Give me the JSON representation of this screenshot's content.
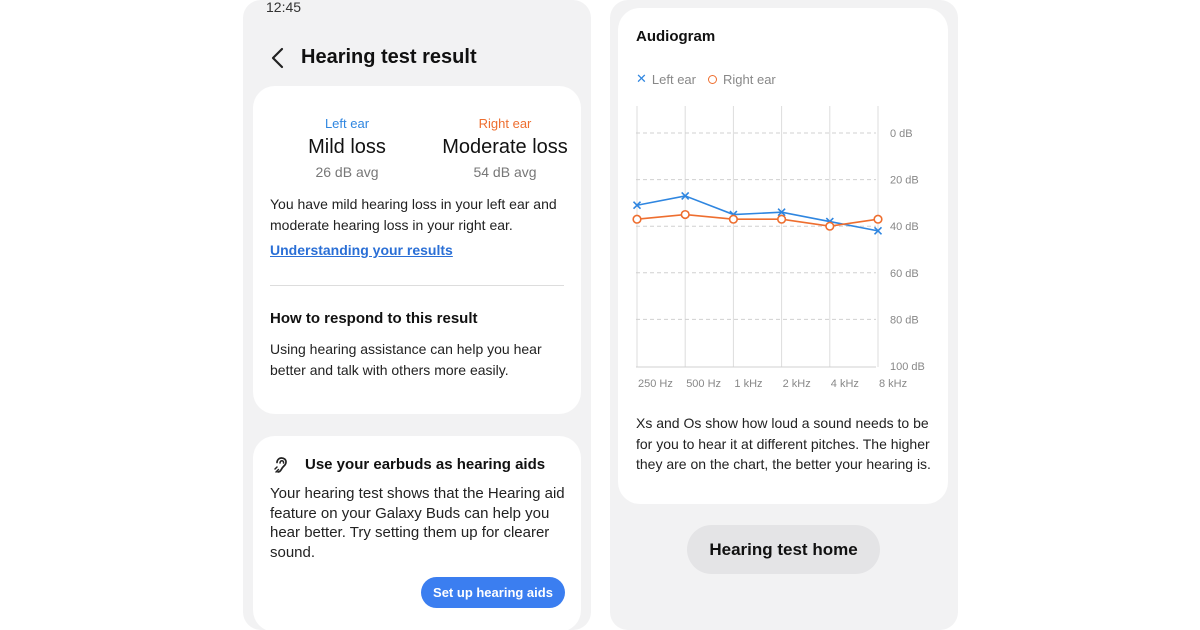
{
  "status_bar": {
    "time": "12:45"
  },
  "result_screen": {
    "title": "Hearing test result",
    "left_ear": {
      "label": "Left ear",
      "result": "Mild loss",
      "avg": "26 dB avg"
    },
    "right_ear": {
      "label": "Right ear",
      "result": "Moderate loss",
      "avg": "54 dB avg"
    },
    "summary": "You have mild hearing loss in your left ear and moderate hearing loss in your right ear.",
    "understanding_link": "Understanding your results",
    "respond_title": "How to respond to this result",
    "respond_text": "Using hearing assistance can help you hear better and talk with others more easily.",
    "earbuds_card": {
      "title": "Use your earbuds as hearing aids",
      "text": "Your hearing test shows that the Hearing aid feature on your Galaxy Buds can help you hear better. Try setting them up for clearer sound.",
      "button": "Set up hearing aids"
    }
  },
  "audiogram_screen": {
    "title": "Audiogram",
    "legend": {
      "left": "Left ear",
      "right": "Right ear"
    },
    "description": "Xs and Os show how loud a sound needs to be for you to hear it at different pitches. The higher they are on the chart, the better your hearing is.",
    "home_button": "Hearing test home"
  },
  "colors": {
    "left_ear": "#2f86e0",
    "right_ear": "#ee6e2f",
    "primary_button": "#3b7ef0"
  },
  "chart_data": {
    "type": "line",
    "title": "Audiogram",
    "categories": [
      "250 Hz",
      "500 Hz",
      "1 kHz",
      "2 kHz",
      "4 kHz",
      "8 kHz"
    ],
    "y_ticks": [
      "0 dB",
      "20 dB",
      "40 dB",
      "60 dB",
      "80 dB",
      "100 dB"
    ],
    "ylim": [
      -10,
      100
    ],
    "y_inverted": true,
    "grid": true,
    "legend_position": "top-left",
    "series": [
      {
        "name": "Left ear",
        "marker": "x",
        "color": "#2f86e0",
        "values": [
          31,
          27,
          35,
          34,
          38,
          42
        ]
      },
      {
        "name": "Right ear",
        "marker": "o",
        "color": "#ee6e2f",
        "values": [
          37,
          35,
          37,
          37,
          40,
          37
        ]
      }
    ]
  }
}
